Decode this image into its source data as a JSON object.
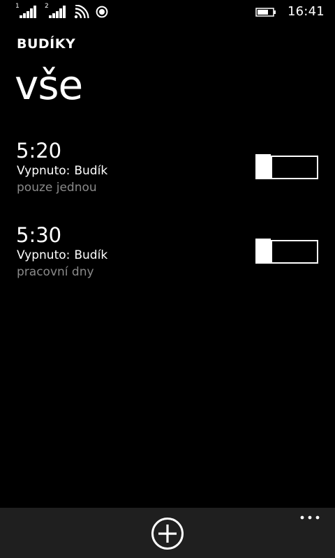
{
  "status_bar": {
    "sim1_label": "1",
    "sim2_label": "2",
    "time": "16:41",
    "icons": [
      "signal-sim1-icon",
      "signal-sim2-icon",
      "wifi-icon",
      "location-icon",
      "battery-icon"
    ]
  },
  "header": {
    "app_title": "BUDÍKY",
    "pivot_title": "vše"
  },
  "alarms": [
    {
      "time": "5:20",
      "state_label": "Vypnuto:",
      "name": "Budík",
      "repeat": "pouze jednou",
      "enabled": false
    },
    {
      "time": "5:30",
      "state_label": "Vypnuto:",
      "name": "Budík",
      "repeat": "pracovní dny",
      "enabled": false
    }
  ],
  "app_bar": {
    "icons": [
      "add-icon",
      "more-icon"
    ]
  },
  "colors": {
    "background": "#000000",
    "text": "#ffffff",
    "secondary_text": "#8a8a8a",
    "app_bar": "#1f1f1f"
  }
}
